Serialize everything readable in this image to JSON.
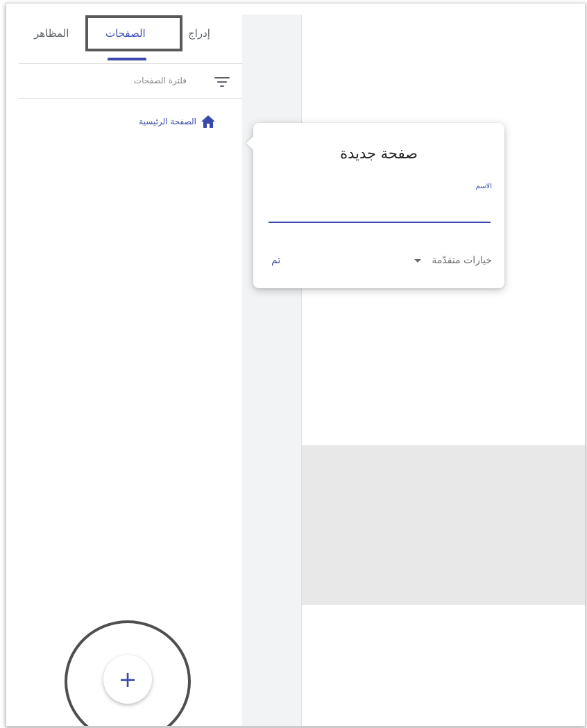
{
  "sidebar": {
    "tabs": [
      {
        "id": "insert",
        "label": "إدراج"
      },
      {
        "id": "pages",
        "label": "الصفحات",
        "selected": true
      },
      {
        "id": "themes",
        "label": "المظاهر"
      }
    ],
    "filter_placeholder": "فلترة الصفحات",
    "pages": [
      {
        "label": "الصفحة الرئيسية",
        "icon": "home-icon"
      }
    ],
    "add_button_symbol": "+"
  },
  "popup": {
    "title": "صفحة جديدة",
    "name_label": "الاسم",
    "name_value": "",
    "advanced_label": "خيارات متقدّمة",
    "done_label": "تم"
  },
  "colors": {
    "accent": "#3949ab",
    "highlight_frame": "#595959",
    "gutter": "#f1f3f4",
    "placeholder_block": "#e8e8e8"
  }
}
